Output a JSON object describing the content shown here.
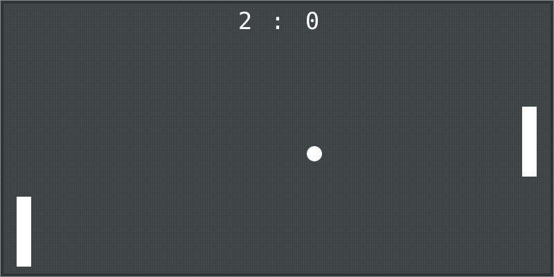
{
  "scoreboard": {
    "left_score": "2",
    "separator": ":",
    "right_score": "0"
  },
  "colors": {
    "court": "#3f4548",
    "frame": "#2f3436",
    "border": "#8a8d8f",
    "pieces": "#ffffff"
  }
}
